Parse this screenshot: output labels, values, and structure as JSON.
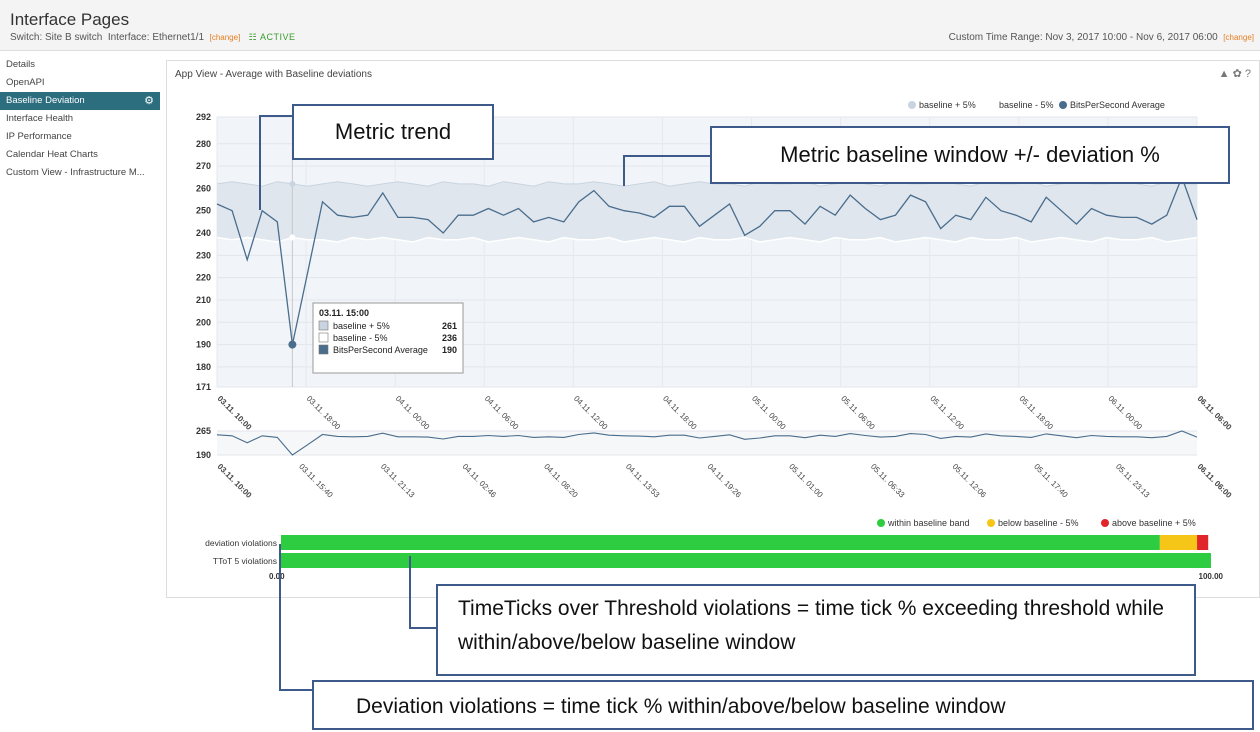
{
  "header": {
    "title": "Interface Pages",
    "switch_label": "Switch:",
    "switch_value": "Site B switch",
    "interface_label": "Interface:",
    "interface_value": "Ethernet1/1",
    "change_label": "[change]",
    "status": "ACTIVE",
    "range_label": "Custom Time Range:",
    "range_value": "Nov 3, 2017 10:00 - Nov 6, 2017 06:00",
    "range_change": "[change]"
  },
  "sidebar": {
    "items": [
      {
        "label": "Details"
      },
      {
        "label": "OpenAPI"
      },
      {
        "label": "Baseline Deviation"
      },
      {
        "label": "Interface Health"
      },
      {
        "label": "IP Performance"
      },
      {
        "label": "Calendar Heat Charts"
      },
      {
        "label": "Custom View - Infrastructure M..."
      }
    ]
  },
  "panel": {
    "title": "App View - Average with Baseline deviations",
    "tools": "▲ ✿ ?"
  },
  "colors": {
    "band": "#dfe6ee",
    "line": "#4a6d8c",
    "within": "#2ecc40",
    "below": "#f5c518",
    "above": "#e0262b",
    "callout_border": "#3e5a8a",
    "sidebar_active": "#2c6e7e"
  },
  "chart_data": {
    "type": "line",
    "legend": {
      "upper": "baseline + 5%",
      "lower": "baseline - 5%",
      "series": "BitsPerSecond Average"
    },
    "ylim": [
      171,
      292
    ],
    "yticks": [
      "292",
      "280",
      "270",
      "260",
      "250",
      "240",
      "230",
      "220",
      "210",
      "200",
      "190",
      "180",
      "171"
    ],
    "xticks": [
      "03.11. 10:00",
      "03.11. 18:00",
      "04.11. 00:00",
      "04.11. 06:00",
      "04.11. 12:00",
      "04.11. 18:00",
      "05.11. 00:00",
      "05.11. 06:00",
      "05.11. 12:00",
      "05.11. 18:00",
      "06.11. 00:00",
      "06.11. 06:00"
    ],
    "upper": [
      262,
      263,
      262,
      261,
      263,
      262,
      261,
      262,
      263,
      262,
      261,
      262,
      263,
      262,
      261,
      263,
      262,
      262,
      261,
      263,
      262,
      261,
      263,
      262,
      262,
      263,
      262,
      261,
      262,
      263,
      261,
      262,
      263,
      262,
      262,
      261,
      263,
      262,
      262,
      263,
      261,
      262,
      263,
      262,
      261,
      263,
      262,
      262,
      263,
      262,
      261,
      263,
      262,
      262,
      263,
      261,
      262,
      263,
      262,
      262,
      263,
      262,
      261,
      263,
      262,
      262
    ],
    "lower": [
      238,
      237,
      238,
      237,
      236,
      238,
      237,
      237,
      236,
      238,
      237,
      238,
      237,
      236,
      238,
      237,
      237,
      238,
      236,
      237,
      238,
      237,
      236,
      238,
      237,
      237,
      238,
      236,
      237,
      238,
      237,
      236,
      238,
      237,
      237,
      238,
      236,
      237,
      238,
      237,
      236,
      238,
      237,
      237,
      238,
      236,
      237,
      238,
      237,
      236,
      238,
      237,
      237,
      238,
      236,
      237,
      238,
      237,
      236,
      238,
      237,
      237,
      238,
      236,
      237,
      238
    ],
    "values": [
      253,
      250,
      228,
      250,
      245,
      190,
      222,
      254,
      248,
      247,
      248,
      258,
      247,
      247,
      246,
      240,
      248,
      248,
      251,
      248,
      251,
      245,
      247,
      245,
      254,
      259,
      252,
      250,
      249,
      247,
      252,
      252,
      243,
      248,
      253,
      239,
      243,
      250,
      250,
      244,
      252,
      248,
      257,
      251,
      246,
      248,
      257,
      254,
      242,
      248,
      246,
      256,
      250,
      248,
      245,
      256,
      250,
      244,
      251,
      248,
      247,
      247,
      244,
      248,
      265,
      246
    ],
    "tooltip": {
      "time": "03.11. 15:00",
      "rows": [
        {
          "label": "baseline + 5%",
          "value": "261"
        },
        {
          "label": "baseline - 5%",
          "value": "236"
        },
        {
          "label": "BitsPerSecond Average",
          "value": "190"
        }
      ]
    },
    "navigator": {
      "yticks": [
        "265",
        "190"
      ],
      "xticks": [
        "03.11. 10:00",
        "03.11. 15:40",
        "03.11. 21:13",
        "04.11. 02:46",
        "04.11. 08:20",
        "04.11. 13:53",
        "04.11. 19:26",
        "05.11. 01:00",
        "05.11. 06:33",
        "05.11. 12:06",
        "05.11. 17:40",
        "05.11. 23:13",
        "06.11. 06:00"
      ]
    },
    "violations": {
      "legend": [
        "within baseline band",
        "below baseline - 5%",
        "above baseline + 5%"
      ],
      "rows": [
        {
          "label": "deviation violations",
          "within": 94.5,
          "below": 4.0,
          "above": 1.2
        },
        {
          "label": "TToT 5 violations",
          "within": 100,
          "below": 0,
          "above": 0
        }
      ],
      "xmin": "0.00",
      "xmax": "100.00"
    }
  },
  "callouts": {
    "metric_trend": "Metric trend",
    "baseline_window": "Metric baseline window +/- deviation %",
    "ttot": "TimeTicks over Threshold violations = time tick % exceeding threshold while within/above/below baseline window",
    "deviation": "Deviation violations = time tick % within/above/below baseline window"
  }
}
